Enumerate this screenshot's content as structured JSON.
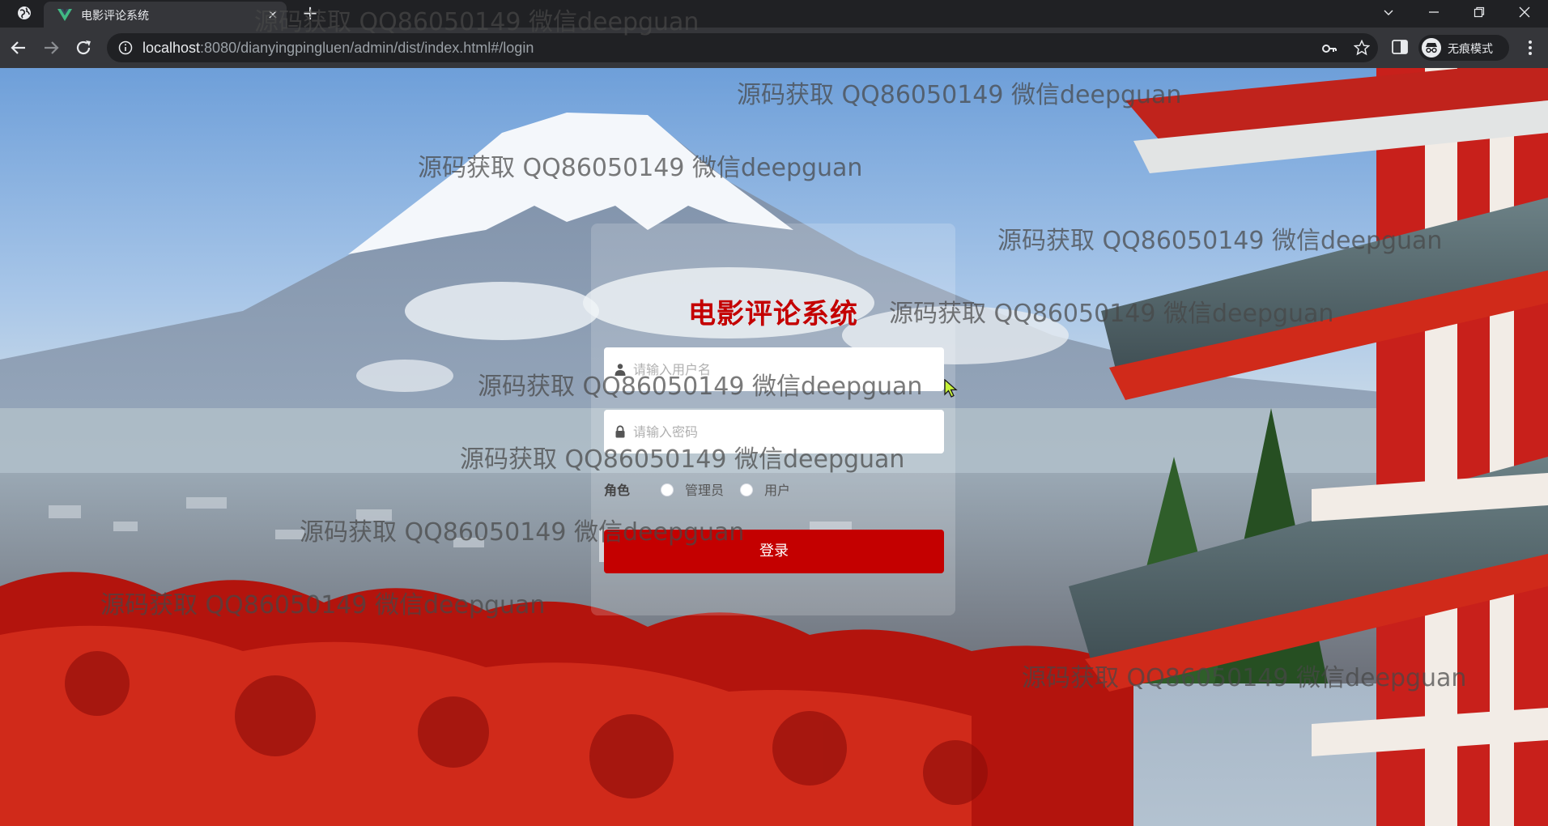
{
  "browser": {
    "tab": {
      "title": "电影评论系统",
      "close_glyph": "×"
    },
    "new_tab_glyph": "+",
    "address": {
      "host": "localhost",
      "path": ":8080/dianyingpinglu​en/admin/dist/index.html#/login"
    },
    "profile": {
      "label": "无痕模式"
    }
  },
  "login": {
    "title": "电影评论系统",
    "username": {
      "placeholder": "请输入用户名",
      "value": ""
    },
    "password": {
      "placeholder": "请输入密码",
      "value": ""
    },
    "role": {
      "label": "角色",
      "options": [
        "管理员",
        "用户"
      ]
    },
    "submit_label": "登录"
  },
  "watermark": {
    "text": "源码获取 QQ86050149 微信deepguan"
  },
  "colors": {
    "brand_red": "#c40000",
    "chrome_dark": "#202124",
    "chrome_toolbar": "#35363a"
  }
}
